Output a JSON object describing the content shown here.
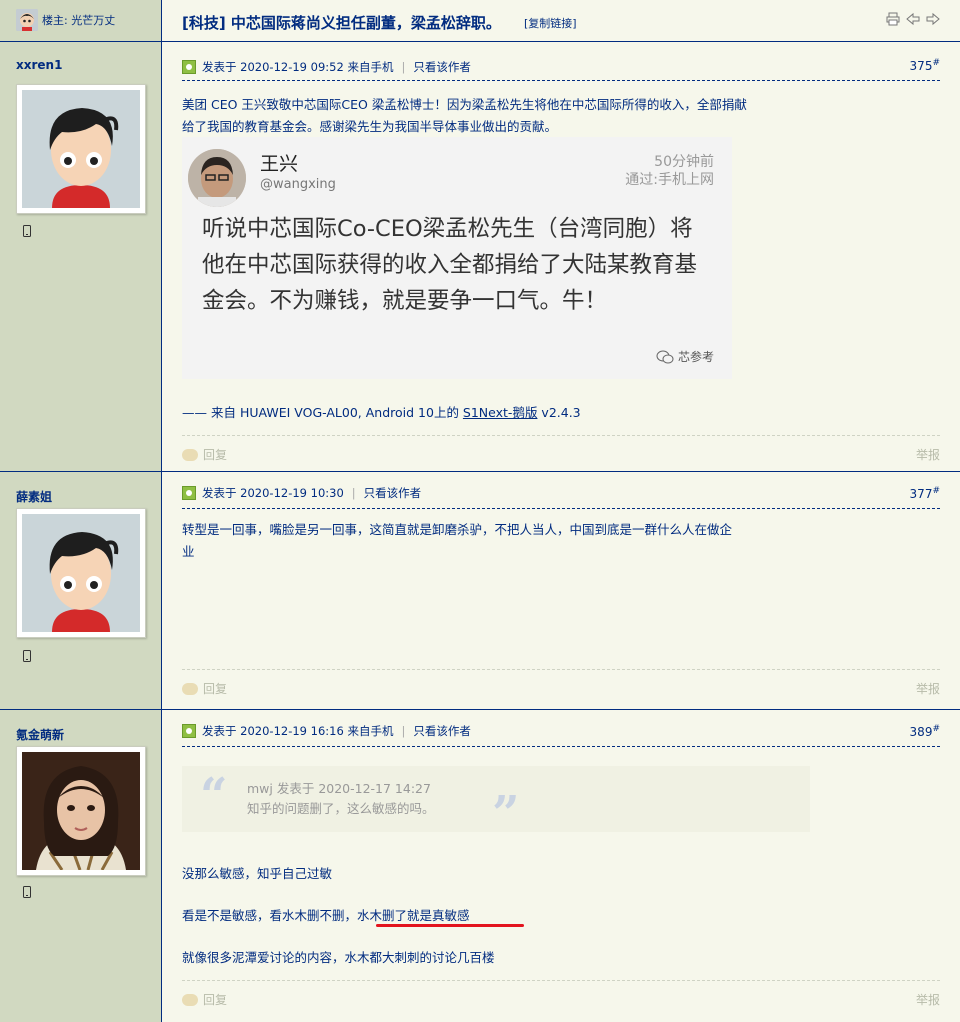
{
  "thread": {
    "op_label": "楼主: 光芒万丈",
    "title": "[科技] 中芯国际蒋尚义担任副董，梁孟松辞职。",
    "copy_link": "[复制链接]"
  },
  "posts": [
    {
      "username": "xxren1",
      "meta_posted": "发表于 2020-12-19 09:52 来自手机",
      "only_author": "只看该作者",
      "floor": "375",
      "floor_mark": "#",
      "content_line1": "美团 CEO 王兴致敬中芯国际CEO 梁孟松博士！因为梁孟松先生将他在中芯国际所得的收入，全部捐献",
      "content_line2": "给了我国的教育基金会。感谢梁先生为我国半导体事业做出的贡献。",
      "weibo": {
        "name": "王兴",
        "handle": "@wangxing",
        "time": "50分钟前",
        "via": "通过:手机上网",
        "text": "听说中芯国际Co-CEO梁孟松先生（台湾同胞）将他在中芯国际获得的收入全都捐给了大陆某教育基金会。不为赚钱，就是要争一口气。牛！",
        "source": "芯参考"
      },
      "signature_prefix": "—— 来自 HUAWEI VOG-AL00, Android 10上的 ",
      "signature_link": "S1Next-鹅版",
      "signature_suffix": " v2.4.3",
      "reply": "回复",
      "report": "举报"
    },
    {
      "username": "薛素姐",
      "meta_posted": "发表于 2020-12-19 10:30",
      "only_author": "只看该作者",
      "floor": "377",
      "floor_mark": "#",
      "content_line1": "转型是一回事，嘴脸是另一回事，这简直就是卸磨杀驴，不把人当人，中国到底是一群什么人在做企",
      "content_line2": "业",
      "reply": "回复",
      "report": "举报"
    },
    {
      "username": "氪金萌新",
      "meta_posted": "发表于 2020-12-19 16:16 来自手机",
      "only_author": "只看该作者",
      "floor": "389",
      "floor_mark": "#",
      "quote_head": "mwj 发表于 2020-12-17 14:27",
      "quote_body": "知乎的问题删了，这么敏感的吗。",
      "line1": "没那么敏感，知乎自己过敏",
      "line2_a": "看是不是敏感，看水木删不删，",
      "line2_b": "水木删了就是真敏感",
      "line3": "就像很多泥潭爱讨论的内容，水木都大刺刺的讨论几百楼",
      "reply": "回复",
      "report": "举报"
    }
  ],
  "colors": {
    "link": "#022c80",
    "side_bg": "#d1d9c1",
    "page_bg": "#f6f7eb",
    "highlight_underline": "#e3141e"
  },
  "icons": [
    "avatar-icon",
    "print-icon",
    "prev-icon",
    "next-icon",
    "online-icon",
    "mobile-icon",
    "reply-icon",
    "wechat-icon"
  ]
}
